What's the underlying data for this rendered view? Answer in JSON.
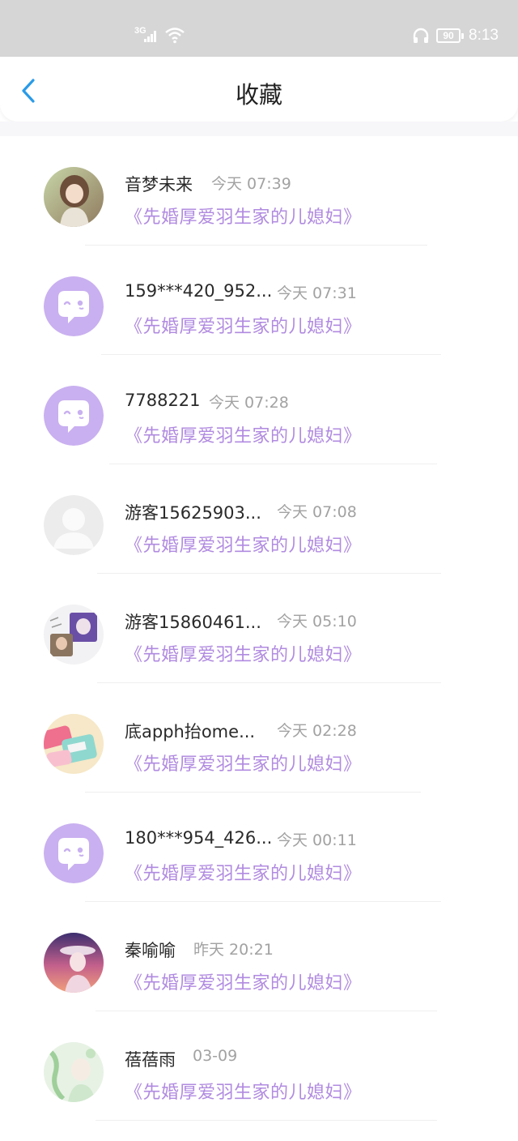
{
  "status_bar": {
    "network": "3G",
    "battery": "90",
    "time": "8:13"
  },
  "header": {
    "title": "收藏"
  },
  "colors": {
    "accent_blue": "#2a9be8",
    "book_purple": "#b18be0",
    "default_avatar_purple": "#c9b0f0"
  },
  "items": [
    {
      "name": "音梦未来",
      "time": "今天 07:39",
      "book": "《先婚厚爱羽生家的儿媳妇》",
      "avatar": "photo-girl-avatar"
    },
    {
      "name": "159***420_952...",
      "time": "今天 07:31",
      "book": "《先婚厚爱羽生家的儿媳妇》",
      "avatar": "default-chat-avatar"
    },
    {
      "name": "7788221",
      "time": "今天 07:28",
      "book": "《先婚厚爱羽生家的儿媳妇》",
      "avatar": "default-chat-avatar"
    },
    {
      "name": "游客15625903...",
      "time": "今天 07:08",
      "book": "《先婚厚爱羽生家的儿媳妇》",
      "avatar": "guest-avatar"
    },
    {
      "name": "游客15860461...",
      "time": "今天 05:10",
      "book": "《先婚厚爱羽生家的儿媳妇》",
      "avatar": "photo-sticker-avatar"
    },
    {
      "name": "底apph抬ome...",
      "time": "今天 02:28",
      "book": "《先婚厚爱羽生家的儿媳妇》",
      "avatar": "photo-cosmetics-avatar"
    },
    {
      "name": "180***954_426...",
      "time": "今天 00:11",
      "book": "《先婚厚爱羽生家的儿媳妇》",
      "avatar": "default-chat-avatar"
    },
    {
      "name": "秦喻喻",
      "time": "昨天 20:21",
      "book": "《先婚厚爱羽生家的儿媳妇》",
      "avatar": "photo-anime-sunset-avatar"
    },
    {
      "name": "蓓蓓雨",
      "time": "03-09",
      "book": "《先婚厚爱羽生家的儿媳妇》",
      "avatar": "photo-green-avatar"
    }
  ]
}
